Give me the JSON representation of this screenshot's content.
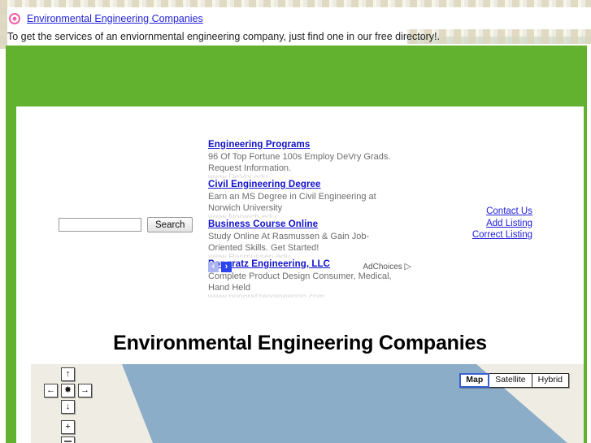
{
  "header": {
    "bullet_icon": "target-circle-icon",
    "site_title_link": "Environmental Engineering Companies",
    "tagline": "To get the services of an enviornmental engineering company, just find one in our free directory!."
  },
  "colors": {
    "green_frame": "#62b12f",
    "link_blue": "#2222dd",
    "ad_title_blue": "#1111cc",
    "map_land": "#efece4",
    "map_water": "#8badc8",
    "bullet_pink": "#f060a8"
  },
  "ads": {
    "items": [
      {
        "title": "Engineering Programs",
        "description": "96 Of Top Fortune 100s Employ DeVry Grads. Request Information.",
        "url": "www.DeVry.edu"
      },
      {
        "title": "Civil Engineering Degree",
        "description": "Earn an MS Degree in Civil Engineering at Norwich University",
        "url": "www.Norwich.edu"
      },
      {
        "title": "Business Course Online",
        "description": "Study Online At Rasmussen & Gain Job-Oriented Skills. Get Started!",
        "url": "www.Rasmussen.edu"
      },
      {
        "title": "Pongratz Engineering, LLC",
        "description": "Complete Product Design Consumer, Medical, Hand Held",
        "url": "www.pongratzengineering.com"
      }
    ],
    "prev_label": "‹",
    "next_label": "›",
    "adchoices_label": "AdChoices",
    "adchoices_glyph": "▷"
  },
  "search": {
    "value": "",
    "placeholder": "",
    "button_label": "Search"
  },
  "side_links": [
    {
      "label": "Contact Us"
    },
    {
      "label": "Add Listing"
    },
    {
      "label": "Correct Listing"
    }
  ],
  "main": {
    "heading": "Environmental Engineering Companies"
  },
  "map": {
    "controls": {
      "pan_up": "↑",
      "pan_left": "←",
      "pan_center": "✸",
      "pan_right": "→",
      "pan_down": "↓",
      "zoom_in": "+"
    },
    "types": [
      {
        "label": "Map",
        "selected": true
      },
      {
        "label": "Satellite",
        "selected": false
      },
      {
        "label": "Hybrid",
        "selected": false
      }
    ]
  }
}
